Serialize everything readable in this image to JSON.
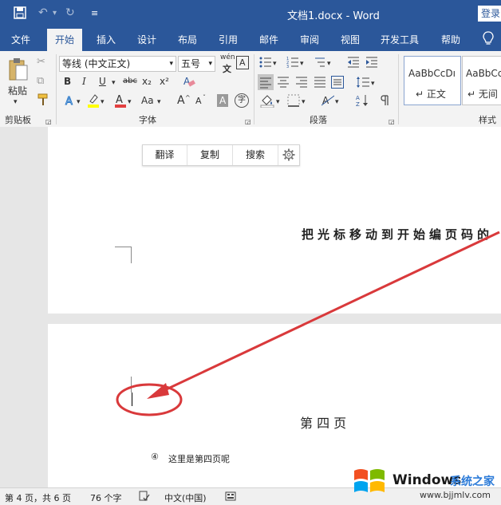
{
  "title_bar": {
    "doc_title": "文档1.docx  -  Word",
    "login_label": "登录",
    "save_icon": "save-icon",
    "undo_icon": "undo-icon",
    "redo_icon": "redo-icon",
    "customize_icon": "customize-quick-access-icon"
  },
  "tabs": [
    "文件",
    "开始",
    "插入",
    "设计",
    "布局",
    "引用",
    "邮件",
    "审阅",
    "视图",
    "开发工具",
    "帮助"
  ],
  "tell_me_icon": "lightbulb-icon",
  "ribbon": {
    "clipboard": {
      "paste_label": "粘贴",
      "group_label": "剪贴板"
    },
    "font": {
      "font_name": "等线 (中文正文)",
      "font_size": "五号",
      "phonetic": "wén",
      "border_char": "A",
      "bold": "B",
      "italic": "I",
      "underline": "U",
      "strike": "abc",
      "subscript": "x₂",
      "superscript": "x²",
      "case": "Aa",
      "grow": "A",
      "shrink": "A",
      "shade": "A",
      "enclose": "字",
      "group_label": "字体"
    },
    "paragraph": {
      "group_label": "段落"
    },
    "styles": {
      "items": [
        {
          "preview": "AaBbCcDı",
          "name": "↵ 正文"
        },
        {
          "preview": "AaBbCc",
          "name": "↵ 无间"
        }
      ],
      "group_label": "样式"
    }
  },
  "mini_toolbar": {
    "translate": "翻译",
    "copy": "复制",
    "search": "搜索"
  },
  "document": {
    "annotation_text": "把光标移动到开始编页码的",
    "page_heading": "第 四 页",
    "footer_number": "④",
    "footer_text": "这里是第四页呢"
  },
  "status_bar": {
    "page_info": "第 4 页，共 6 页",
    "word_count": "76 个字",
    "language": "中文(中国)"
  },
  "watermark": {
    "brand": "Windows",
    "brand_cn": "系统之家",
    "url": "www.bjjmlv.com"
  },
  "colors": {
    "accent": "#2b579a",
    "annotation_red": "#d9393b",
    "highlight_yellow": "#ffff00",
    "font_red": "#e23f3f"
  }
}
